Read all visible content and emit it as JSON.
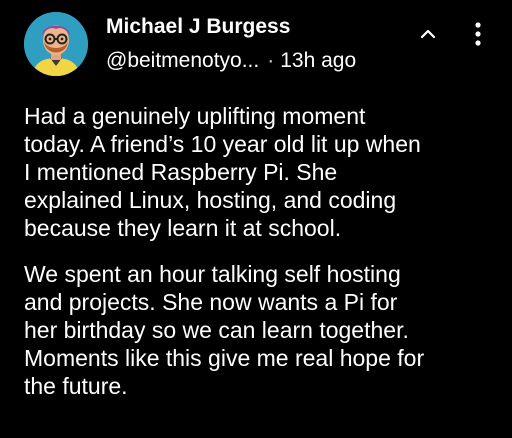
{
  "post": {
    "author": {
      "name": "Michael J Burgess",
      "handle": "@beitmenotyo...",
      "avatar_icon": "cartoon-avatar-icon"
    },
    "separator": "·",
    "timestamp": "13h ago",
    "actions": {
      "collapse_icon": "chevron-up-icon",
      "more_icon": "more-vertical-icon"
    },
    "paragraphs": [
      "Had a genuinely uplifting moment\ntoday. A friend’s 10 year old lit up when\nI mentioned Raspberry Pi. She\nexplained Linux, hosting, and coding\nbecause they learn it at school.",
      "We spent an hour talking self hosting\nand projects. She now wants a Pi for\nher birthday so we can learn together.\nMoments like this give me real hope for\nthe future."
    ]
  },
  "colors": {
    "background": "#000000",
    "text": "#ffffff",
    "avatar_bg": "#2f9ec0",
    "avatar_shirt": "#f2d544",
    "avatar_hair": "#8a4fa0"
  }
}
